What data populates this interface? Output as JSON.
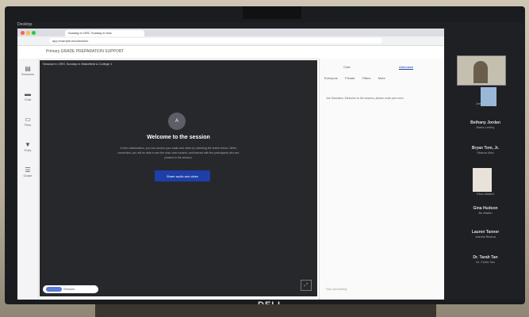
{
  "os": {
    "label": "Desktop"
  },
  "browser": {
    "tab_title": "Sunday in GRC Sunday in Nov",
    "url": "app.example.edu/session"
  },
  "app": {
    "title": "Primary GRADE PREPARATION SUPPORT",
    "nav": [
      {
        "label": "Sessions",
        "icon": "calendar-icon"
      },
      {
        "label": "Chat",
        "icon": "chat-icon"
      },
      {
        "label": "Files",
        "icon": "files-icon"
      },
      {
        "label": "Polls",
        "icon": "poll-icon"
      },
      {
        "label": "Grade",
        "icon": "grade-icon"
      }
    ],
    "stage": {
      "label": "Session in GRC Sunday in Wakefield & College 1",
      "avatar_initial": "A",
      "welcome": "Welcome to the session",
      "description": "In this collaboration, you can access your audio and video by selecting the button below. When connected, you will be able to see the chat, view content, and interact with the participants who are present in the session.",
      "join_button": "Share audio and video",
      "expand_label": "⤢"
    },
    "status": {
      "text": "Session"
    },
    "right_panel": {
      "tabs": [
        "Chat",
        "Attendees"
      ],
      "tools": [
        "Everyone",
        "Private",
        "Filters",
        "More"
      ],
      "message": "Joe Saunders: Welcome to the session, please mute your mics",
      "footer": "Say something"
    }
  },
  "participants": [
    {
      "name": "",
      "sub": "Joe Saunders"
    },
    {
      "name": "Bethany Jordan",
      "sub": "Maria Lesley"
    },
    {
      "name": "Bryan Tom, Jr.",
      "sub": "Sharon Alex"
    },
    {
      "name": "",
      "sub": "Eliza Walker"
    },
    {
      "name": "Gina Hudson",
      "sub": "Bo Martin"
    },
    {
      "name": "Lauren Tanner",
      "sub": "Juanita Bianca"
    },
    {
      "name": "Dr. Tarah Tan",
      "sub": "Dr. Fortis Tan"
    }
  ],
  "monitor": {
    "brand": "DELL"
  },
  "colors": {
    "accent": "#1e3fa8",
    "stage": "#27282c"
  }
}
